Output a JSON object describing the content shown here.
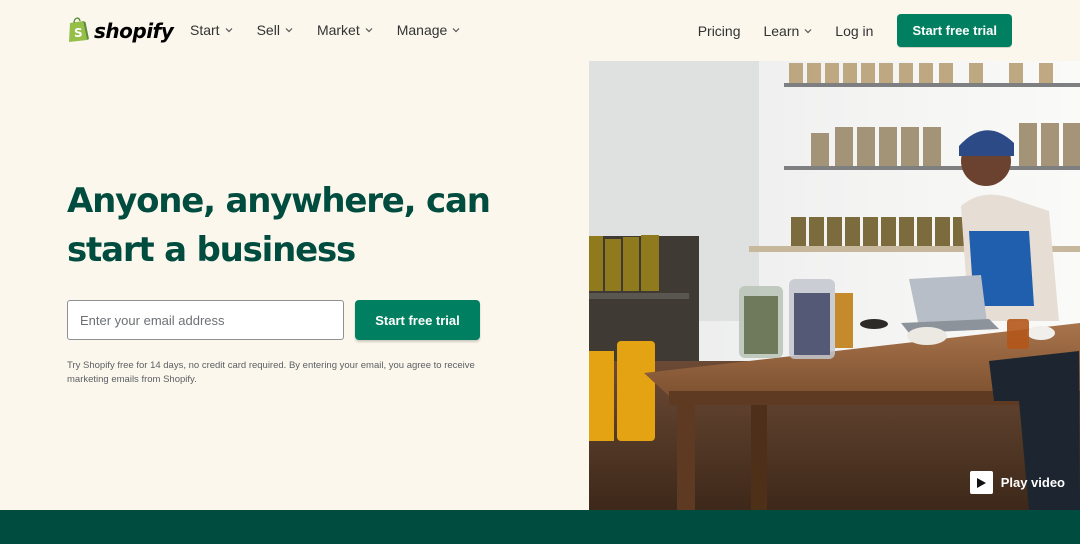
{
  "nav": {
    "brand": "shopify",
    "left_items": [
      {
        "label": "Start"
      },
      {
        "label": "Sell"
      },
      {
        "label": "Market"
      },
      {
        "label": "Manage"
      }
    ],
    "pricing": "Pricing",
    "learn": "Learn",
    "login": "Log in",
    "cta": "Start free trial"
  },
  "hero": {
    "title_line1": "Anyone, anywhere, can",
    "title_line2": "start a business",
    "email_placeholder": "Enter your email address",
    "cta": "Start free trial",
    "disclaimer": "Try Shopify free for 14 days, no credit card required. By entering your email, you agree to receive marketing emails from Shopify."
  },
  "media": {
    "play_label": "Play video"
  },
  "colors": {
    "brand_green": "#008060",
    "heading_green": "#004c3f",
    "background": "#fbf7ed",
    "logo_green": "#95bf47"
  }
}
